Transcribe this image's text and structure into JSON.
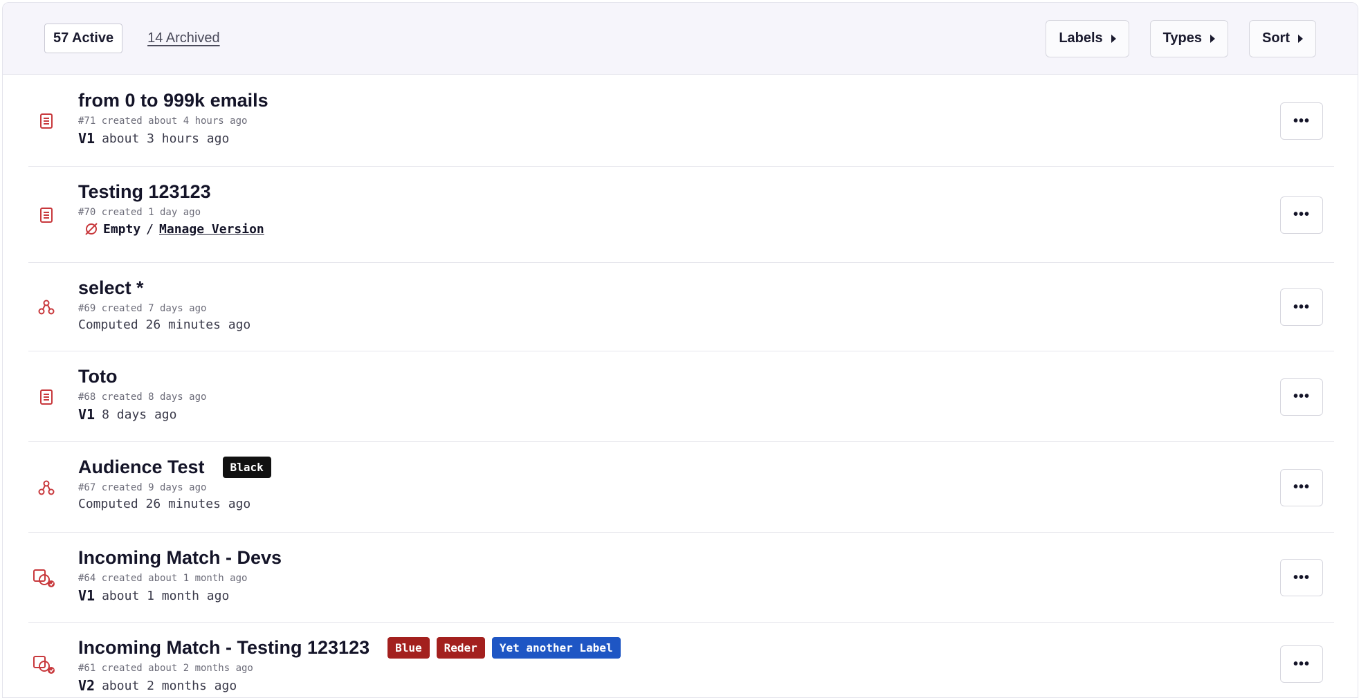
{
  "toolbar": {
    "active_label": "57 Active",
    "archived_label": "14 Archived",
    "labels_button": "Labels",
    "types_button": "Types",
    "sort_button": "Sort"
  },
  "colors": {
    "icon_red": "#c8383c",
    "badge_black": "#111111",
    "badge_red": "#a3201e",
    "badge_blue": "#1e56c4"
  },
  "rows": [
    {
      "icon": "document-icon",
      "title": "from 0 to 999k emails",
      "meta": "#71 created about 4 hours ago",
      "version_tag": "V1",
      "version_text": "about 3 hours ago",
      "badges": []
    },
    {
      "icon": "document-icon",
      "title": "Testing 123123",
      "meta": "#70 created 1 day ago",
      "empty_label": "Empty",
      "separator": "/",
      "manage_label": "Manage Version",
      "badges": []
    },
    {
      "icon": "graph-nodes-icon",
      "title": "select *",
      "meta": "#69 created 7 days ago",
      "version_text": "Computed 26 minutes ago",
      "badges": []
    },
    {
      "icon": "document-icon",
      "title": "Toto",
      "meta": "#68 created 8 days ago",
      "version_tag": "V1",
      "version_text": "8 days ago",
      "badges": []
    },
    {
      "icon": "graph-nodes-icon",
      "title": "Audience Test",
      "meta": "#67 created 9 days ago",
      "version_text": "Computed 26 minutes ago",
      "badges": [
        {
          "label": "Black",
          "color": "#111111"
        }
      ]
    },
    {
      "icon": "match-icon",
      "title": "Incoming Match - Devs",
      "meta": "#64 created about 1 month ago",
      "version_tag": "V1",
      "version_text": "about 1 month ago",
      "badges": []
    },
    {
      "icon": "match-icon",
      "title": "Incoming Match - Testing 123123",
      "meta": "#61 created about 2 months ago",
      "version_tag": "V2",
      "version_text": "about 2 months ago",
      "badges": [
        {
          "label": "Blue",
          "color": "#a3201e"
        },
        {
          "label": "Reder",
          "color": "#a3201e"
        },
        {
          "label": "Yet another Label",
          "color": "#1e56c4"
        }
      ]
    }
  ],
  "more_button_label": "•••"
}
